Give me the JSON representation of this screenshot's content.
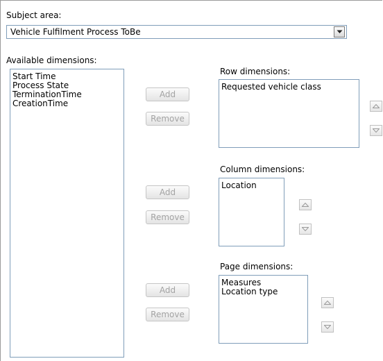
{
  "subject_area": {
    "label": "Subject area:",
    "selected": "Vehicle Fulfilment Process ToBe",
    "icon": "chevron-down-icon"
  },
  "available": {
    "label": "Available dimensions:",
    "items": [
      "Start Time",
      "Process State",
      "TerminationTime",
      "CreationTime"
    ]
  },
  "row": {
    "label": "Row dimensions:",
    "items": [
      "Requested vehicle class"
    ],
    "add_label": "Add",
    "remove_label": "Remove"
  },
  "column": {
    "label": "Column dimensions:",
    "items": [
      "Location"
    ],
    "add_label": "Add",
    "remove_label": "Remove"
  },
  "page": {
    "label": "Page dimensions:",
    "items": [
      "Measures",
      "Location type"
    ],
    "add_label": "Add",
    "remove_label": "Remove"
  },
  "colors": {
    "border": "#7f9db9",
    "disabled_text": "#a3a3a3"
  }
}
